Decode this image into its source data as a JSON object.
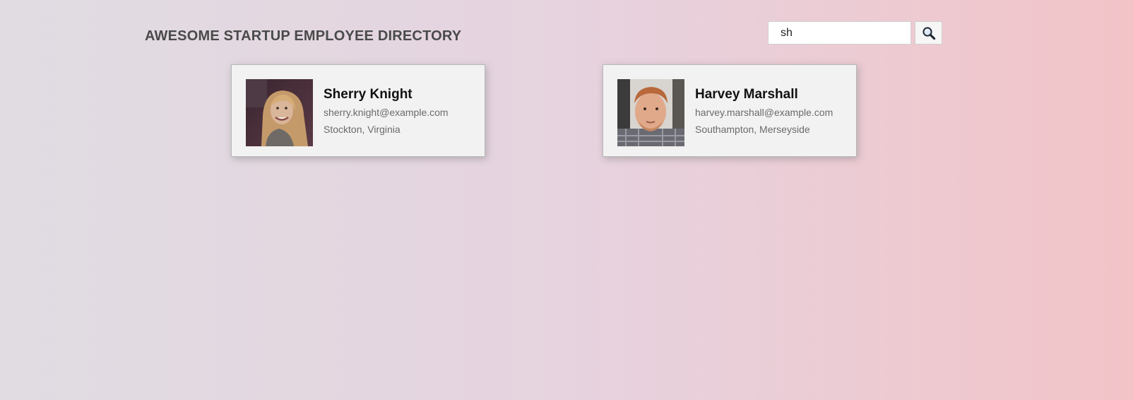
{
  "header": {
    "title": "AWESOME STARTUP EMPLOYEE DIRECTORY"
  },
  "search": {
    "value": "sh",
    "button_icon": "magnifying-glass-icon"
  },
  "employees": [
    {
      "name": "Sherry Knight",
      "email": "sherry.knight@example.com",
      "location": "Stockton, Virginia",
      "avatar": "photo of smiling woman with long blonde hair"
    },
    {
      "name": "Harvey Marshall",
      "email": "harvey.marshall@example.com",
      "location": "Southampton, Merseyside",
      "avatar": "photo of man with short red hair"
    }
  ],
  "colors": {
    "title_text": "#4a4a4a",
    "card_background": "#f2f2f2",
    "secondary_text": "#6a6a6a"
  }
}
